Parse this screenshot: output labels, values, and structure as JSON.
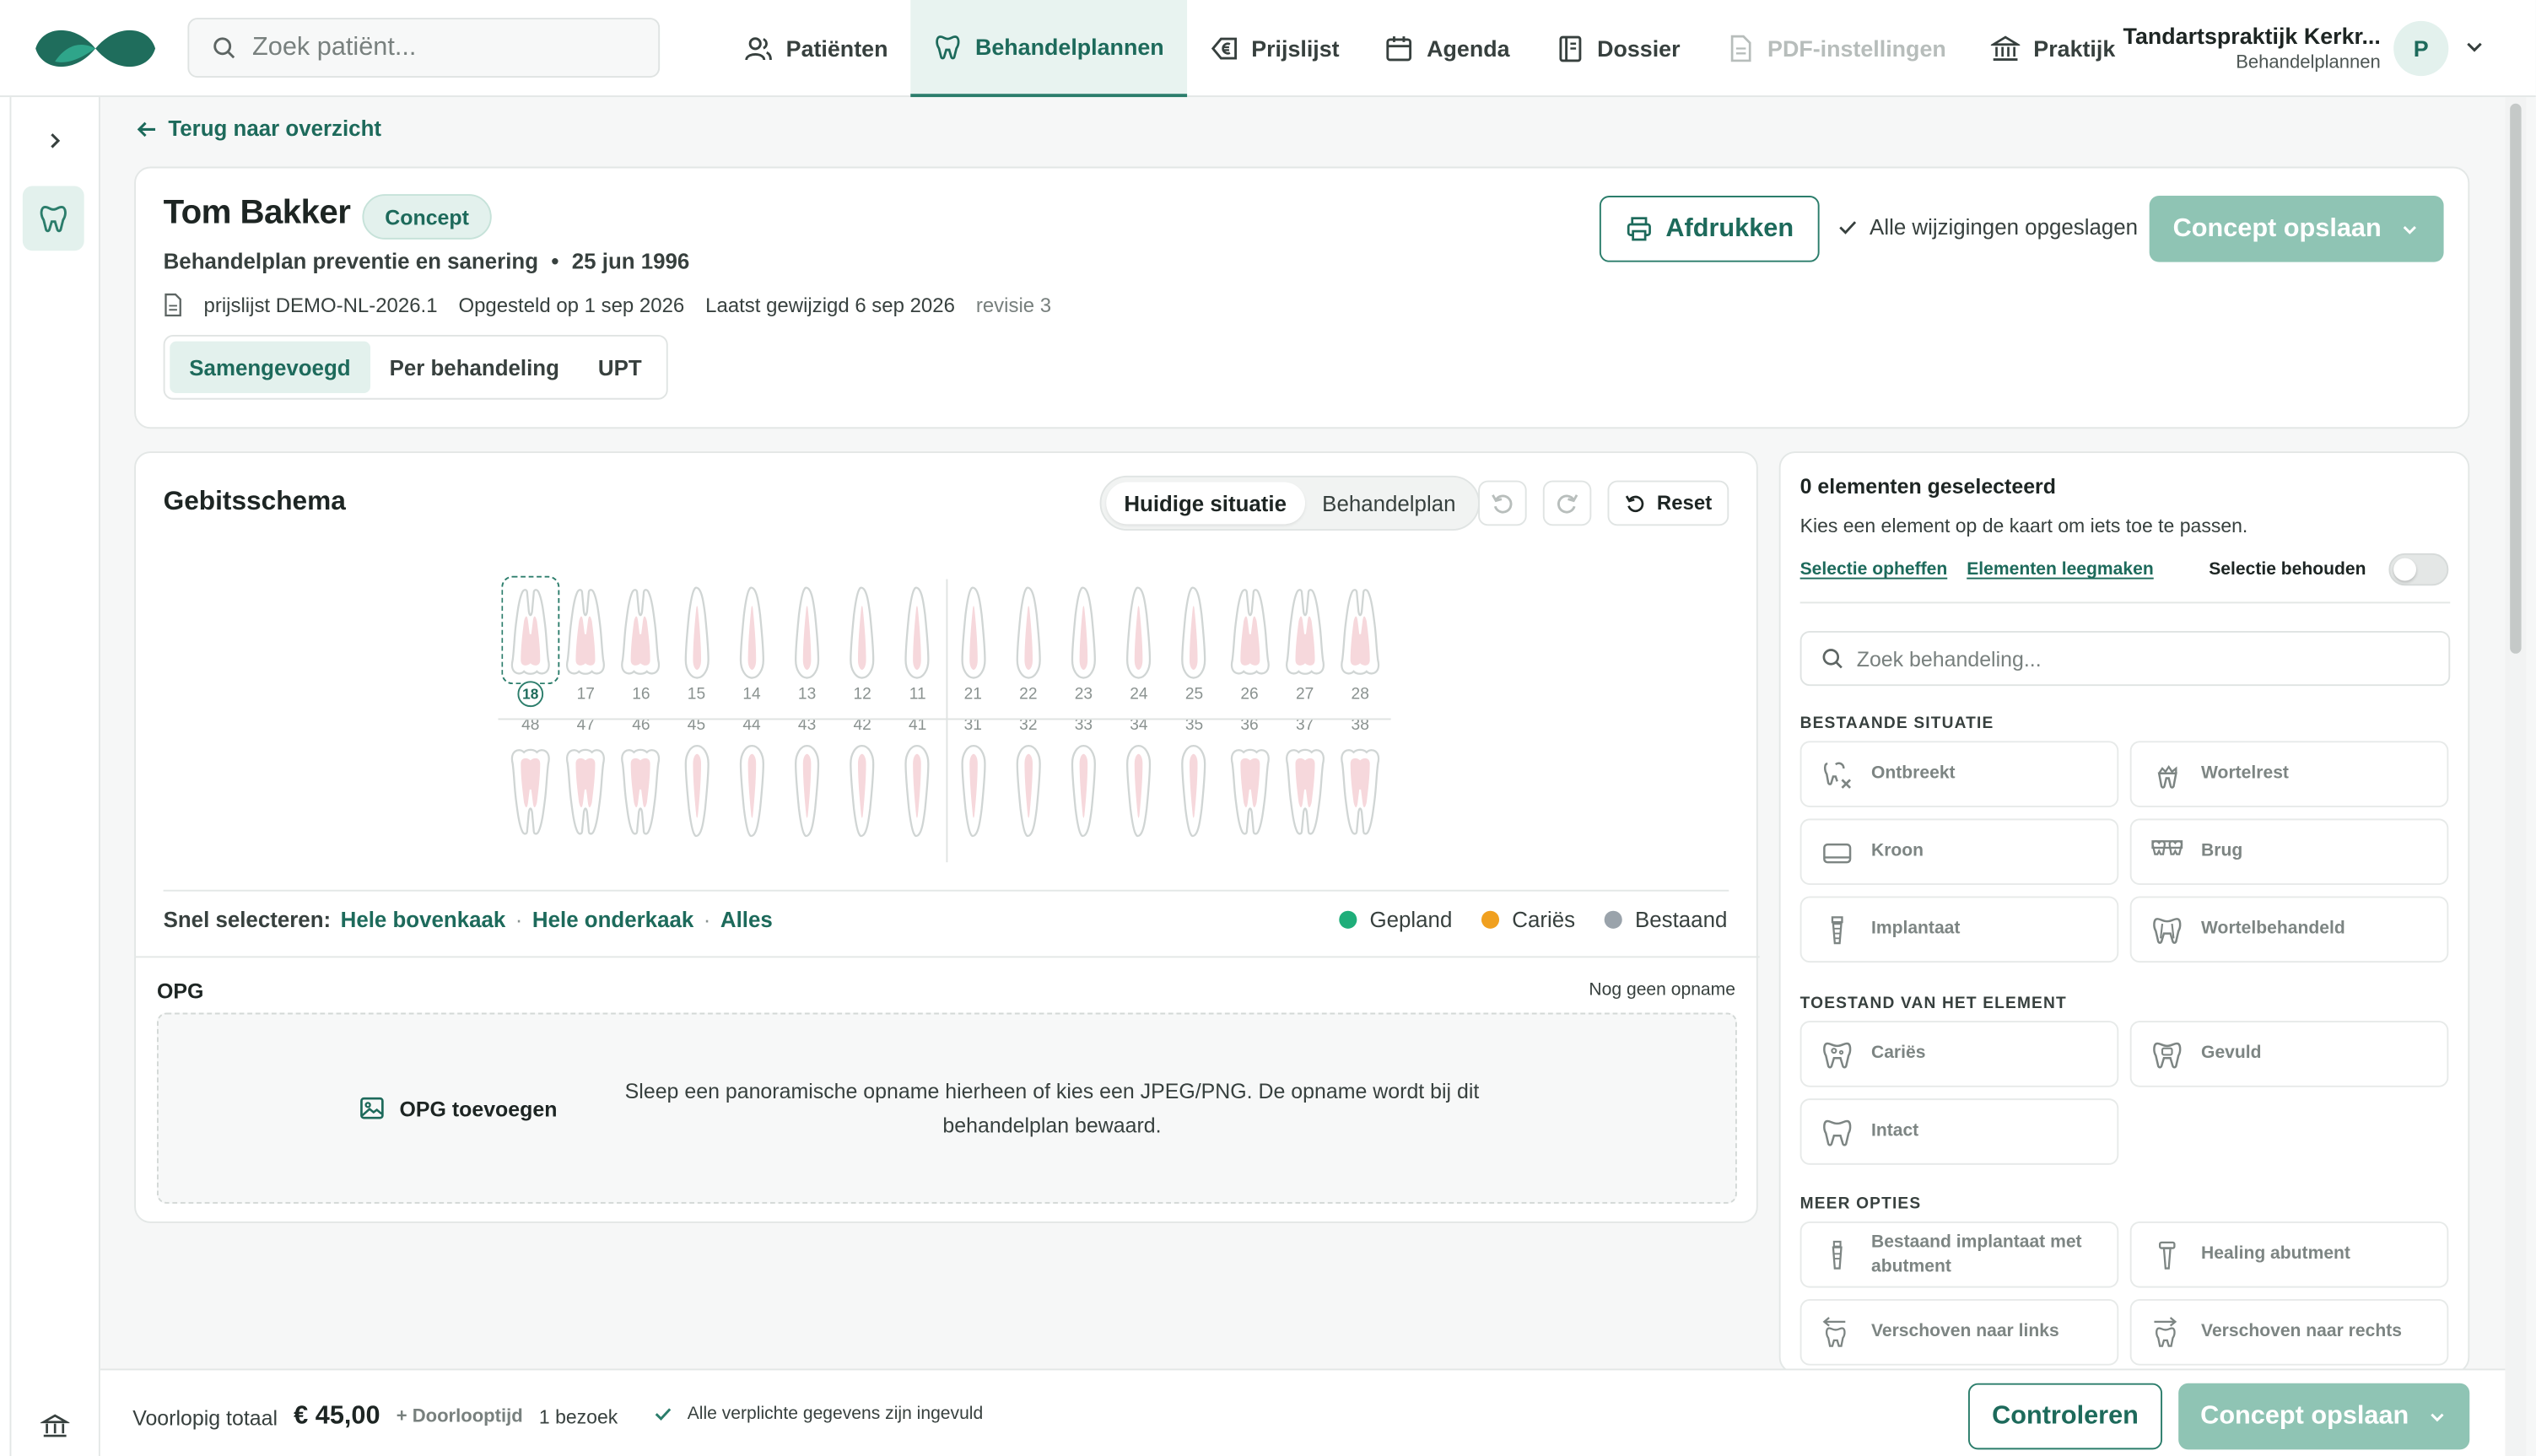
{
  "top": {
    "search_placeholder": "Zoek patiënt...",
    "nav": [
      {
        "label": "Patiënten",
        "icon": "users-icon",
        "state": "normal"
      },
      {
        "label": "Behandelplannen",
        "icon": "tooth-icon",
        "state": "active"
      },
      {
        "label": "Prijslijst",
        "icon": "euro-tag-icon",
        "state": "normal"
      },
      {
        "label": "Agenda",
        "icon": "calendar-icon",
        "state": "normal"
      },
      {
        "label": "Dossier",
        "icon": "binder-icon",
        "state": "normal"
      },
      {
        "label": "PDF-instellingen",
        "icon": "file-icon",
        "state": "disabled"
      },
      {
        "label": "Praktijk",
        "icon": "bank-icon",
        "state": "normal"
      }
    ],
    "practice_name": "Tandartspraktijk Kerkr...",
    "practice_sub": "Behandelplannen",
    "avatar_initial": "P"
  },
  "back_link": "Terug naar overzicht",
  "header": {
    "patient_name": "Tom Bakker",
    "status_badge": "Concept",
    "plan_name": "Behandelplan preventie en sanering",
    "bullet": "•",
    "dob": "25 jun 1996",
    "pricelist": "prijslijst DEMO-NL-2026.1",
    "created": "Opgesteld op 1 sep 2026",
    "modified": "Laatst gewijzigd 6 sep 2026",
    "revision": "revisie 3",
    "tabs": [
      "Samengevoegd",
      "Per behandeling",
      "UPT"
    ],
    "print_label": "Afdrukken",
    "saved_status": "Alle wijzigingen opgeslagen",
    "save_label": "Concept opslaan"
  },
  "chart": {
    "title": "Gebitsschema",
    "view_options": [
      "Huidige situatie",
      "Behandelplan"
    ],
    "reset_label": "Reset",
    "upper_teeth": [
      "18",
      "17",
      "16",
      "15",
      "14",
      "13",
      "12",
      "11",
      "21",
      "22",
      "23",
      "24",
      "25",
      "26",
      "27",
      "28"
    ],
    "lower_teeth": [
      "48",
      "47",
      "46",
      "45",
      "44",
      "43",
      "42",
      "41",
      "31",
      "32",
      "33",
      "34",
      "35",
      "36",
      "37",
      "38"
    ],
    "selected_tooth": "18",
    "quick_select_label": "Snel selecteren:",
    "quick_upper": "Hele bovenkaak",
    "quick_lower": "Hele onderkaak",
    "quick_all": "Alles",
    "sep": "·",
    "legend": [
      {
        "label": "Gepland",
        "color": "#1fae7a"
      },
      {
        "label": "Cariës",
        "color": "#f0a020"
      },
      {
        "label": "Bestaand",
        "color": "#9aa3ab"
      }
    ],
    "accent": "#2b7d6b"
  },
  "opg": {
    "title": "OPG",
    "status": "Nog geen opname",
    "add_label": "OPG toevoegen",
    "drop_text": "Sleep een panoramische opname hierheen of kies een JPEG/PNG. De opname wordt bij dit behandelplan bewaard."
  },
  "side": {
    "title": "0 elementen geselecteerd",
    "subtitle": "Kies een element op de kaart om iets toe te passen.",
    "clear_selection": "Selectie opheffen",
    "empty_elements": "Elementen leegmaken",
    "keep_selection": "Selectie behouden",
    "search_placeholder": "Zoek behandeling...",
    "sections": [
      {
        "title": "BESTAANDE SITUATIE",
        "options": [
          {
            "label": "Ontbreekt",
            "icon": "tooth-missing-icon"
          },
          {
            "label": "Wortelrest",
            "icon": "root-remnant-icon"
          },
          {
            "label": "Kroon",
            "icon": "crown-icon"
          },
          {
            "label": "Brug",
            "icon": "bridge-icon"
          },
          {
            "label": "Implantaat",
            "icon": "implant-icon"
          },
          {
            "label": "Wortelbehandeld",
            "icon": "root-canal-icon"
          }
        ]
      },
      {
        "title": "TOESTAND VAN HET ELEMENT",
        "options": [
          {
            "label": "Cariës",
            "icon": "caries-icon"
          },
          {
            "label": "Gevuld",
            "icon": "filling-icon"
          },
          {
            "label": "Intact",
            "icon": "tooth-intact-icon"
          }
        ]
      },
      {
        "title": "MEER OPTIES",
        "options": [
          {
            "label": "Bestaand implantaat met abutment",
            "icon": "implant-abutment-icon"
          },
          {
            "label": "Healing abutment",
            "icon": "healing-abutment-icon"
          },
          {
            "label": "Verschoven naar links",
            "icon": "shift-left-icon"
          },
          {
            "label": "Verschoven naar rechts",
            "icon": "shift-right-icon"
          }
        ]
      }
    ]
  },
  "footer": {
    "total_label": "Voorlopig totaal",
    "total_value": "€ 45,00",
    "extra": "+ Doorlooptijd",
    "visits": "1 bezoek",
    "ok_text": "Alle verplichte gegevens zijn ingevuld",
    "check_label": "Controleren",
    "save_label": "Concept opslaan"
  }
}
